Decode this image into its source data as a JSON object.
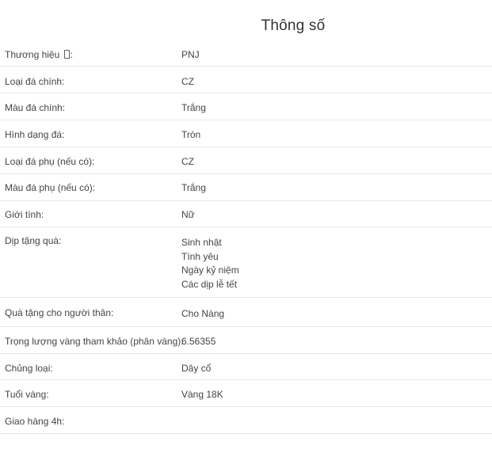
{
  "section": {
    "title": "Thông số"
  },
  "specs": [
    {
      "label": "Thương hiệu ",
      "label_suffix": ":",
      "value": "PNJ"
    },
    {
      "label": "Loại đá chính:",
      "value": "CZ"
    },
    {
      "label": "Màu đá chính:",
      "value": "Trắng"
    },
    {
      "label": "Hình dạng đá:",
      "value": "Tròn"
    },
    {
      "label": "Loại đá phụ (nếu có):",
      "value": "CZ"
    },
    {
      "label": "Màu đá phụ (nếu có):",
      "value": "Trắng"
    },
    {
      "label": "Giới tính:",
      "value": "Nữ"
    },
    {
      "label": "Dịp tặng quà:",
      "values": [
        "Sinh nhật",
        "Tình yêu",
        "Ngày kỷ niệm",
        "Các dịp lễ tết"
      ]
    },
    {
      "label": "Quà tặng cho người thân:",
      "value": "Cho Nàng"
    },
    {
      "label": "Trọng lượng vàng tham khảo (phân vàng):",
      "value": "6.56355"
    },
    {
      "label": "Chủng loại:",
      "value": "Dây cổ"
    },
    {
      "label": "Tuổi vàng:",
      "value": "Vàng 18K"
    },
    {
      "label": "Giao hàng 4h:",
      "value": ""
    }
  ]
}
